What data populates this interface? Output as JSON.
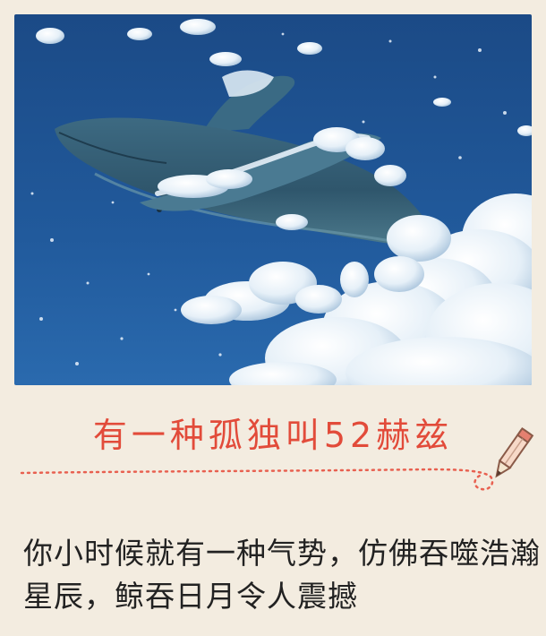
{
  "title": "有一种孤独叫52赫兹",
  "body": {
    "line1": "你小时候就有一种气势，仿佛吞噬浩瀚",
    "line2": "星辰，鲸吞日月令人震撼"
  },
  "colors": {
    "background": "#f3ece0",
    "title": "#e24b3a",
    "sky": "#1d4f8c",
    "dotline": "#e86050"
  },
  "icons": [
    "whale-illustration",
    "pencil-icon"
  ]
}
